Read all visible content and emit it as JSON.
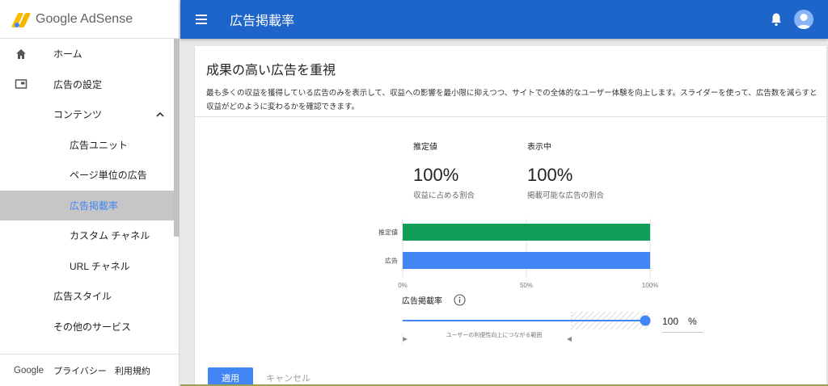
{
  "app": {
    "logo_text": "Google AdSense",
    "page_title": "広告掲載率"
  },
  "sidebar": {
    "items": [
      {
        "label": "ホーム",
        "icon": "home-icon"
      },
      {
        "label": "広告の設定",
        "icon": "ad-settings-icon"
      },
      {
        "label": "コンテンツ",
        "icon": "chevron-up-icon"
      },
      {
        "label": "広告ユニット"
      },
      {
        "label": "ページ単位の広告"
      },
      {
        "label": "広告掲載率",
        "active": true
      },
      {
        "label": "カスタム チャネル"
      },
      {
        "label": "URL チャネル"
      },
      {
        "label": "広告スタイル"
      },
      {
        "label": "その他のサービス"
      }
    ],
    "footer": {
      "google": "Google",
      "privacy": "プライバシー",
      "terms": "利用規約"
    }
  },
  "card": {
    "title": "成果の高い広告を重視",
    "description": "最も多くの収益を獲得している広告のみを表示して、収益への影響を最小限に抑えつつ、サイトでの全体的なユーザー体験を向上します。スライダーを使って、広告数を減らすと収益がどのように変わるかを確認できます。"
  },
  "metrics": {
    "estimate": {
      "label": "推定値",
      "value": "100%",
      "sub": "収益に占める割合"
    },
    "showing": {
      "label": "表示中",
      "value": "100%",
      "sub": "掲載可能な広告の割合"
    }
  },
  "chart_data": {
    "type": "bar",
    "orientation": "horizontal",
    "categories": [
      "推定値",
      "広告"
    ],
    "values": [
      100,
      100
    ],
    "colors": [
      "#0f9d58",
      "#4285f4"
    ],
    "xlim": [
      0,
      100
    ],
    "xticks": [
      "0%",
      "50%",
      "100%"
    ]
  },
  "slider": {
    "label": "広告掲載率",
    "value": "100",
    "unit": "%",
    "fill_fraction": 1.0,
    "range_caption": "ユーザーの利便性向上につながる範囲"
  },
  "actions": {
    "apply": "適用",
    "cancel": "キャンセル"
  },
  "colors": {
    "topbar": "#1e65c9",
    "accent": "#4285f4",
    "green": "#0f9d58"
  }
}
